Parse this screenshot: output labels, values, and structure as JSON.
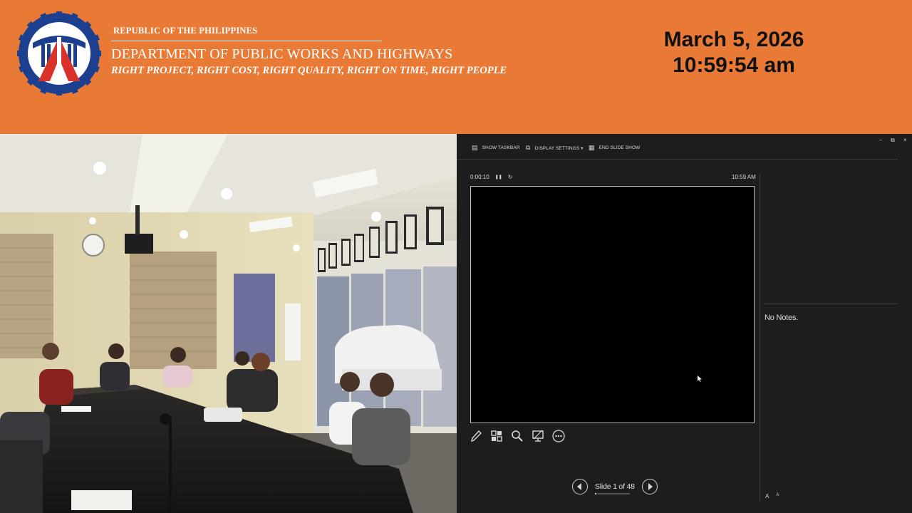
{
  "header": {
    "republic": "REPUBLIC OF THE PHILIPPINES",
    "department": "DEPARTMENT OF PUBLIC WORKS AND HIGHWAYS",
    "motto": "RIGHT PROJECT, RIGHT COST, RIGHT QUALITY, RIGHT ON TIME, RIGHT PEOPLE",
    "date": "March 5, 2026",
    "time": "10:59:54 am",
    "colors": {
      "background": "#e87a35",
      "logo_blue": "#1d3f8f",
      "logo_red": "#d8322a"
    }
  },
  "presenter": {
    "toolbar": {
      "show_taskbar": "SHOW TASKBAR",
      "display_settings": "DISPLAY SETTINGS ▾",
      "end_slide_show": "END SLIDE SHOW"
    },
    "window_controls": {
      "minimize": "–",
      "restore": "⧉",
      "close": "×"
    },
    "timer": "0:00:10",
    "pause_symbol": "❚❚",
    "reset_symbol": "↻",
    "clock": "10:59 AM",
    "notes": "No Notes.",
    "tools": [
      "pen-icon",
      "see-all-slides-icon",
      "zoom-icon",
      "black-screen-icon",
      "more-options-icon"
    ],
    "slide_counter": "Slide 1 of 48",
    "current_slide": 1,
    "total_slides": 48,
    "font_increase": "A",
    "font_decrease": "A"
  }
}
